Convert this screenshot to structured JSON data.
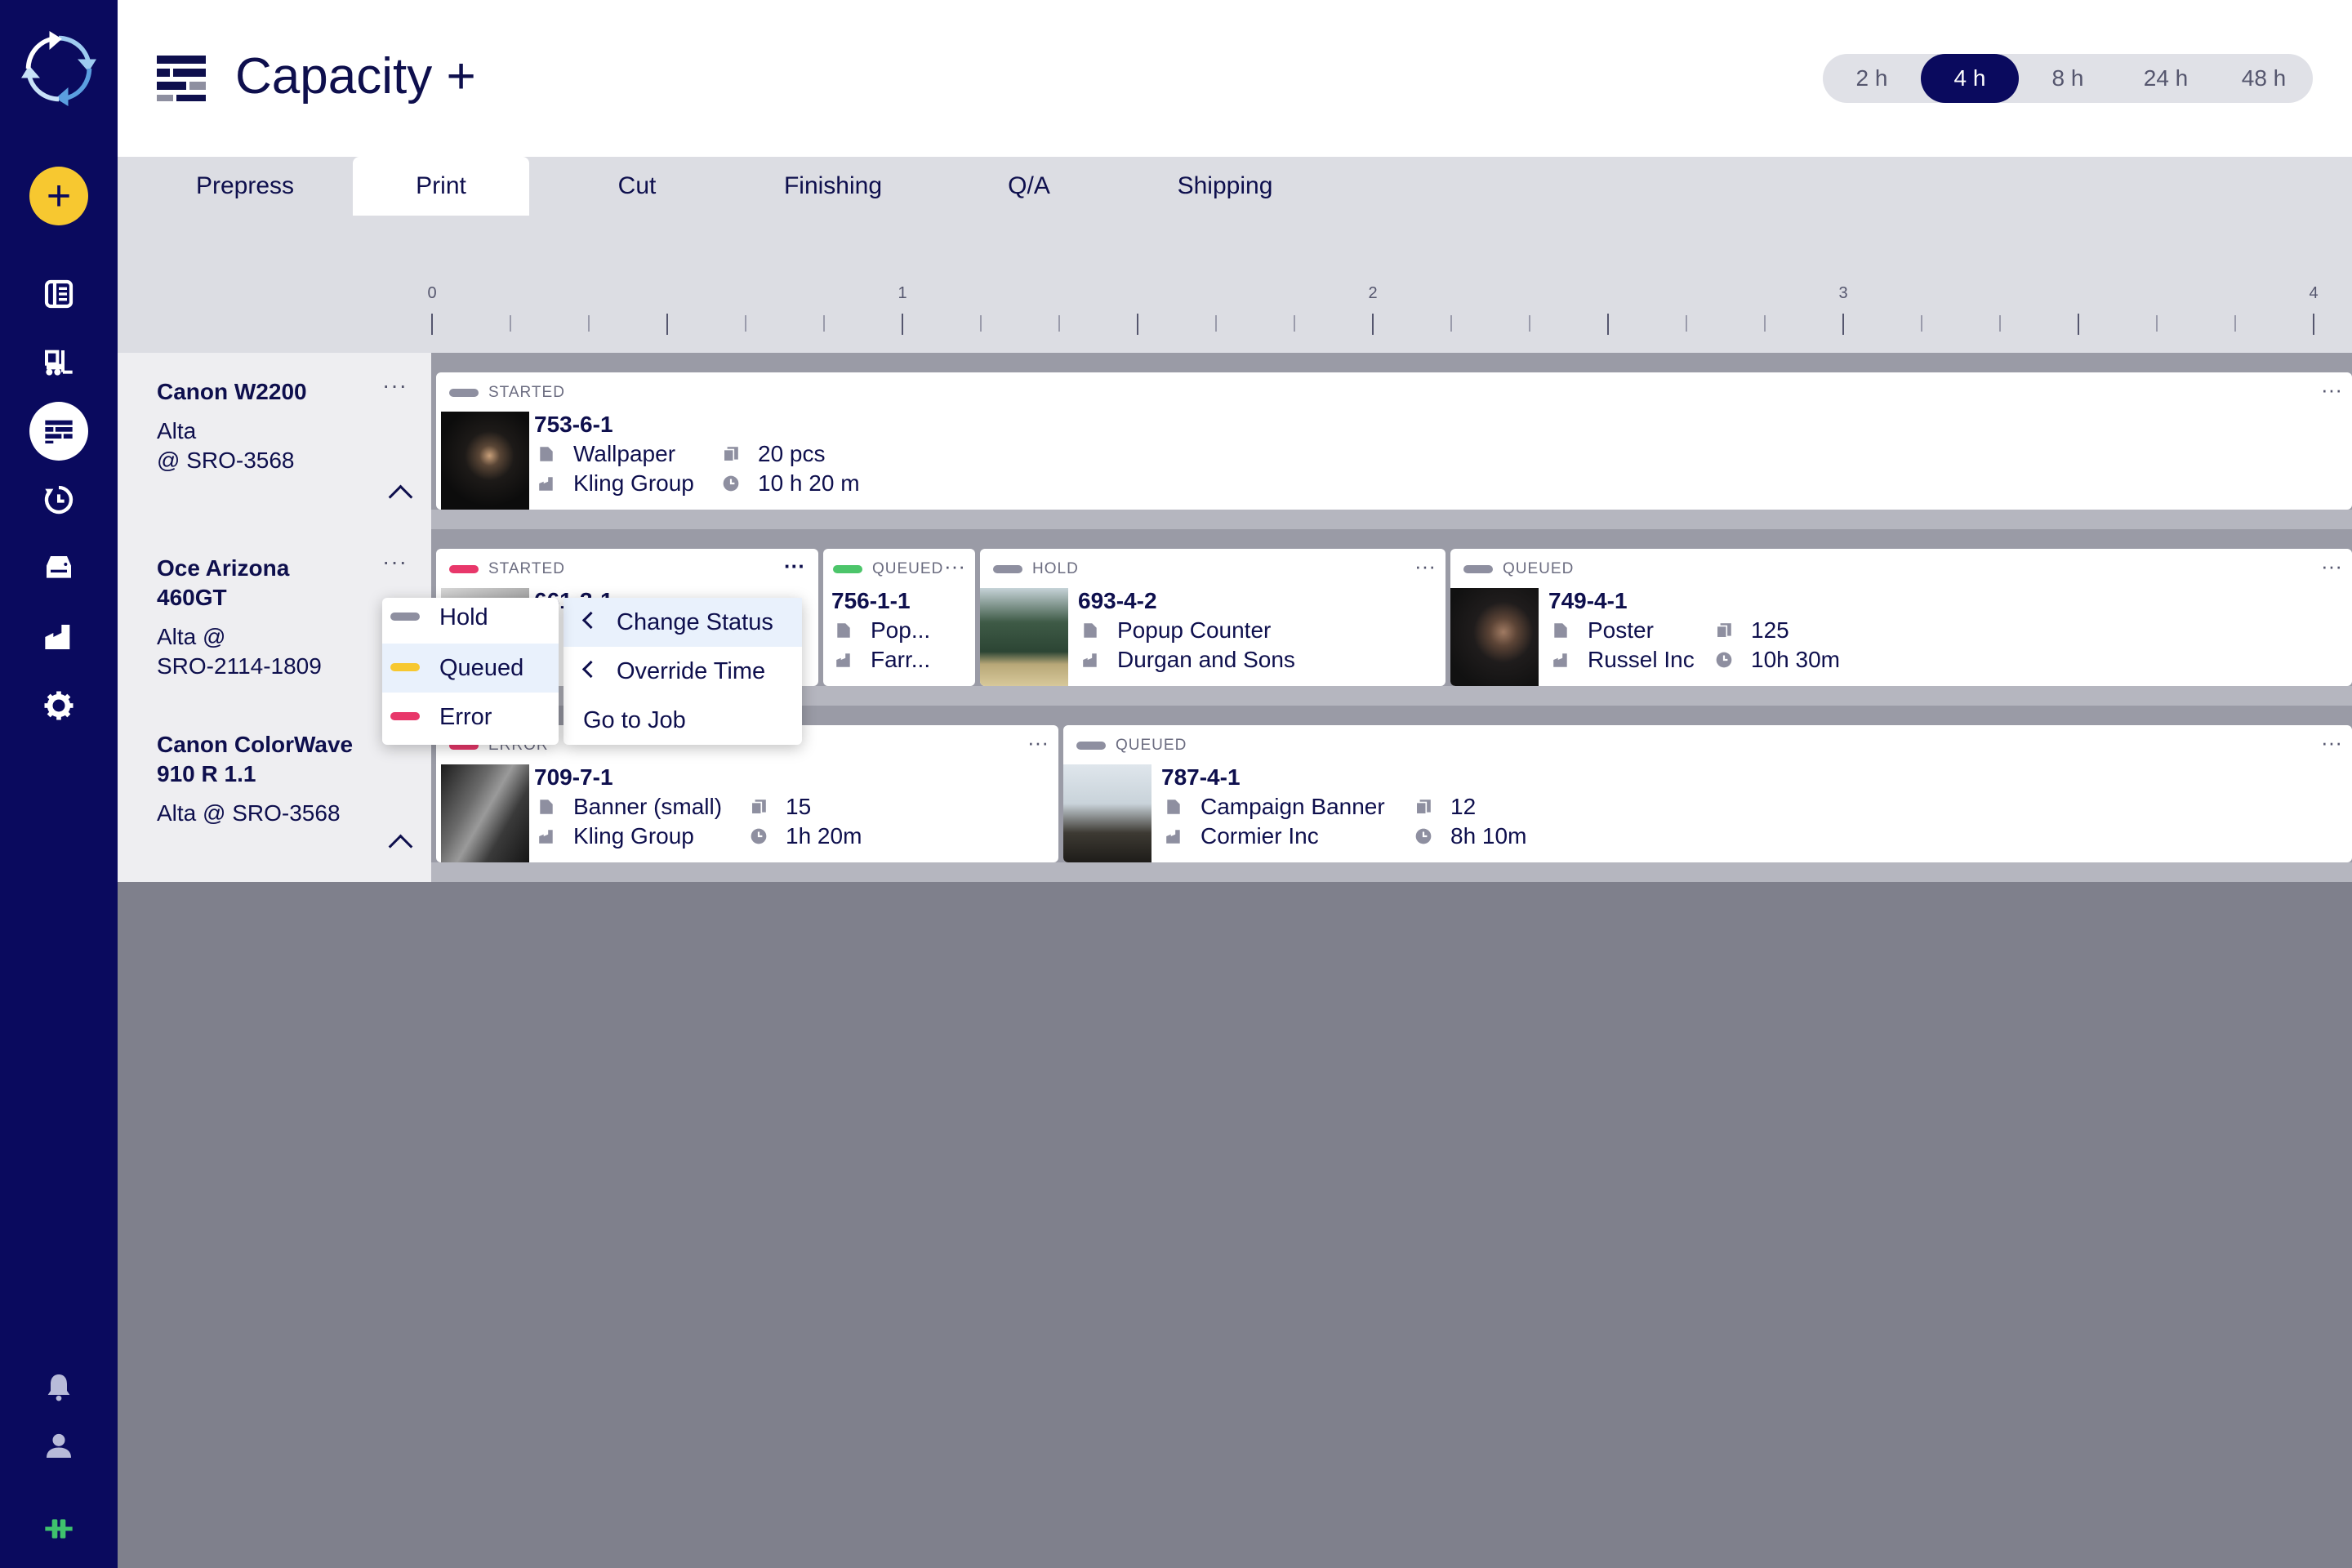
{
  "app": {
    "title": "Capacity +"
  },
  "colors": {
    "sidebar": "#0a0a5e",
    "accent_add": "#f7c830",
    "started_red": "#e8376a",
    "queued_green": "#4cc56a",
    "queued_yellow": "#f7c830",
    "neutral_pill": "#8e8fa0"
  },
  "time_range": {
    "options": [
      "2 h",
      "4 h",
      "8 h",
      "24 h",
      "48 h"
    ],
    "selected": "4 h"
  },
  "tabs": [
    "Prepress",
    "Print",
    "Cut",
    "Finishing",
    "Q/A",
    "Shipping"
  ],
  "active_tab": "Print",
  "ruler": {
    "labels": [
      "0",
      "1",
      "2",
      "3",
      "4"
    ]
  },
  "sidebar": {
    "icons": [
      "app-logo-icon",
      "add-icon",
      "book-icon",
      "forklift-icon",
      "capacity-icon",
      "clock-icon",
      "printer-icon",
      "factory-icon",
      "gear-icon",
      "bell-icon",
      "user-icon",
      "connector-icon"
    ]
  },
  "machines": [
    {
      "name": "Canon W2200",
      "sub1": "Alta",
      "sub2": "@ SRO-3568",
      "more": "···"
    },
    {
      "name_l1": "Oce Arizona",
      "name_l2": "460GT",
      "sub1": "Alta @",
      "sub2": "SRO-2114-1809",
      "more": "···"
    },
    {
      "name_l1": "Canon ColorWave",
      "name_l2": "910 R 1.1",
      "sub1": "Alta @ SRO-3568"
    }
  ],
  "jobs": {
    "j753": {
      "status": "STARTED",
      "id": "753-6-1",
      "product": "Wallpaper",
      "customer": "Kling Group",
      "qty": "20 pcs",
      "time": "10 h 20 m",
      "more": "···"
    },
    "j661": {
      "status": "STARTED",
      "id": "661-3-1",
      "more": "···"
    },
    "j756": {
      "status": "QUEUED",
      "id": "756-1-1",
      "product": "Pop...",
      "customer": "Farr...",
      "more": "···"
    },
    "j693": {
      "status": "HOLD",
      "id": "693-4-2",
      "product": "Popup Counter",
      "customer": "Durgan and Sons",
      "more": "···"
    },
    "j749": {
      "status": "QUEUED",
      "id": "749-4-1",
      "product": "Poster",
      "customer": "Russel Inc",
      "qty": "125",
      "time": "10h 30m",
      "more": "···"
    },
    "j709": {
      "status": "ERROR",
      "id": "709-7-1",
      "product": "Banner (small)",
      "customer": "Kling Group",
      "qty": "15",
      "time": "1h 20m",
      "more": "···"
    },
    "j787": {
      "status": "QUEUED",
      "id": "787-4-1",
      "product": "Campaign Banner",
      "customer": "Cormier Inc",
      "qty": "12",
      "time": "8h 10m",
      "more": "···"
    }
  },
  "context_menu": {
    "items": [
      "Change Status",
      "Override Time",
      "Go to Job"
    ]
  },
  "status_submenu": {
    "items": [
      "Hold",
      "Queued",
      "Error"
    ],
    "highlighted": "Queued"
  }
}
